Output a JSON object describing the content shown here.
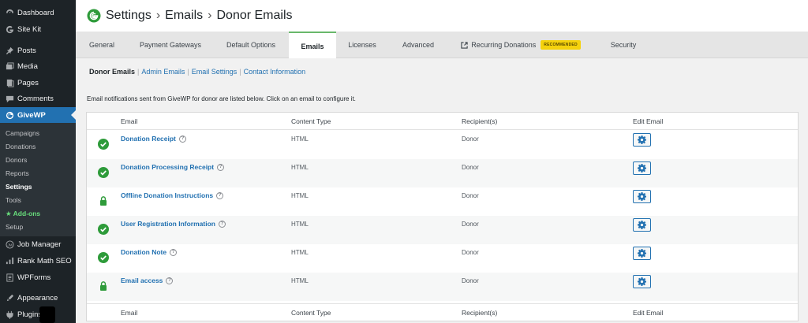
{
  "sidebar": {
    "items": [
      {
        "label": "Dashboard",
        "icon": "dashboard-icon"
      },
      {
        "label": "Site Kit",
        "icon": "site-kit-icon"
      },
      {
        "label": "Posts",
        "icon": "pin-icon"
      },
      {
        "label": "Media",
        "icon": "media-icon"
      },
      {
        "label": "Pages",
        "icon": "pages-icon"
      },
      {
        "label": "Comments",
        "icon": "comment-icon"
      },
      {
        "label": "GiveWP",
        "icon": "givewp-icon"
      },
      {
        "label": "Job Manager",
        "icon": "job-manager-icon"
      },
      {
        "label": "Rank Math SEO",
        "icon": "rank-math-icon"
      },
      {
        "label": "WPForms",
        "icon": "wpforms-icon"
      },
      {
        "label": "Appearance",
        "icon": "appearance-icon"
      },
      {
        "label": "Plugins",
        "icon": "plugins-icon"
      }
    ],
    "submenu": [
      "Campaigns",
      "Donations",
      "Donors",
      "Reports",
      "Settings",
      "Tools",
      "Add-ons",
      "Setup"
    ]
  },
  "header": {
    "crumb1": "Settings",
    "crumb2": "Emails",
    "crumb3": "Donor Emails",
    "separator": "›"
  },
  "tabs": [
    "General",
    "Payment Gateways",
    "Default Options",
    "Emails",
    "Licenses",
    "Advanced",
    "Recurring Donations",
    "Security"
  ],
  "tab_badge": "RECOMMENDED",
  "subnav": [
    "Donor Emails",
    "Admin Emails",
    "Email Settings",
    "Contact Information"
  ],
  "description": "Email notifications sent from GiveWP for donor are listed below. Click on an email to configure it.",
  "table": {
    "columns": [
      "Email",
      "Content Type",
      "Recipient(s)",
      "Edit Email"
    ],
    "rows": [
      {
        "name": "Donation Receipt",
        "type": "HTML",
        "recipient": "Donor",
        "status": "enabled"
      },
      {
        "name": "Donation Processing Receipt",
        "type": "HTML",
        "recipient": "Donor",
        "status": "enabled"
      },
      {
        "name": "Offline Donation Instructions",
        "type": "HTML",
        "recipient": "Donor",
        "status": "locked"
      },
      {
        "name": "User Registration Information",
        "type": "HTML",
        "recipient": "Donor",
        "status": "enabled"
      },
      {
        "name": "Donation Note",
        "type": "HTML",
        "recipient": "Donor",
        "status": "enabled"
      },
      {
        "name": "Email access",
        "type": "HTML",
        "recipient": "Donor",
        "status": "locked"
      }
    ]
  },
  "help_glyph": "?",
  "colors": {
    "accent": "#2271b1",
    "success": "#2e9b3a",
    "tab_highlight": "#69b86b",
    "badge": "#f5d20d"
  }
}
